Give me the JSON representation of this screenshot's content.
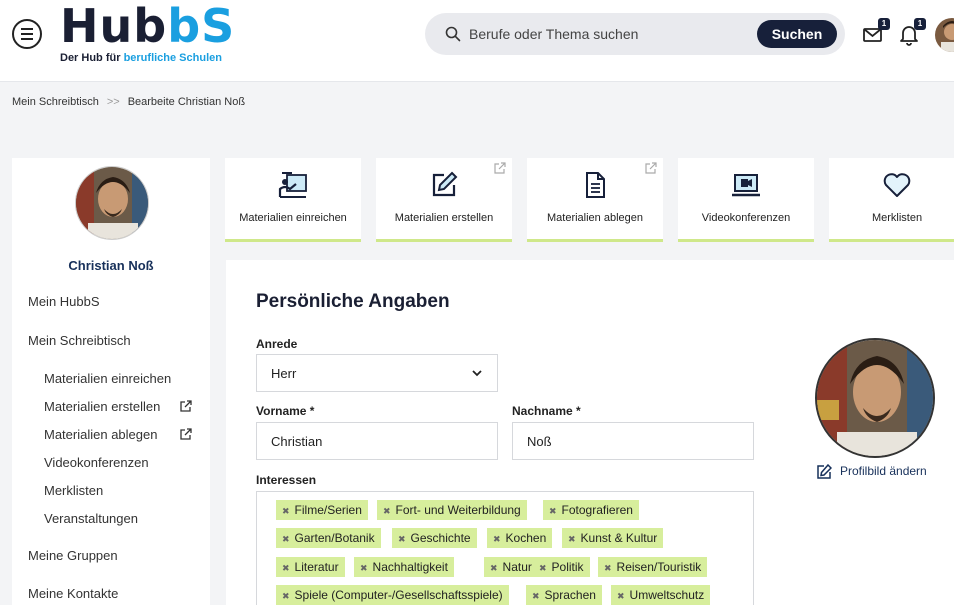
{
  "header": {
    "logo": {
      "word_dark": "Hub",
      "word_blue": "bS",
      "tagline_dark": "Der Hub für ",
      "tagline_blue": "berufliche Schulen"
    },
    "search": {
      "placeholder": "Berufe oder Thema suchen",
      "button_label": "Suchen"
    },
    "notifications": {
      "messages_count": "1",
      "bell_count": "1"
    }
  },
  "breadcrumb": {
    "items": [
      "Mein Schreibtisch",
      "Bearbeite Christian Noß"
    ],
    "separator": ">>"
  },
  "sidebar": {
    "user_name": "Christian Noß",
    "items": [
      {
        "label": "Mein HubbS"
      },
      {
        "label": "Mein Schreibtisch"
      },
      {
        "label": "Materialien einreichen"
      },
      {
        "label": "Materialien erstellen"
      },
      {
        "label": "Materialien ablegen"
      },
      {
        "label": "Videokonferenzen"
      },
      {
        "label": "Merklisten"
      },
      {
        "label": "Veranstaltungen"
      },
      {
        "label": "Meine Gruppen"
      },
      {
        "label": "Meine Kontakte"
      }
    ]
  },
  "tiles": [
    {
      "label": "Materialien einreichen",
      "icon": "presenter-icon"
    },
    {
      "label": "Materialien erstellen",
      "icon": "edit-icon"
    },
    {
      "label": "Materialien ablegen",
      "icon": "document-icon"
    },
    {
      "label": "Videokonferenzen",
      "icon": "video-icon"
    },
    {
      "label": "Merklisten",
      "icon": "heart-icon"
    }
  ],
  "form": {
    "title": "Persönliche Angaben",
    "anrede": {
      "label": "Anrede",
      "value": "Herr"
    },
    "vorname": {
      "label": "Vorname *",
      "value": "Christian"
    },
    "nachname": {
      "label": "Nachname *",
      "value": "Noß"
    },
    "interessen": {
      "label": "Interessen",
      "tags": [
        "Filme/Serien",
        "Fort- und Weiterbildung",
        "Fotografieren",
        "Garten/Botanik",
        "Geschichte",
        "Kochen",
        "Kunst & Kultur",
        "Literatur",
        "Nachhaltigkeit",
        "Natur",
        "Politik",
        "Reisen/Touristik",
        "Spiele (Computer-/Gesellschaftsspiele)",
        "Sprachen",
        "Umweltschutz"
      ]
    },
    "profile_change_label": "Profilbild ändern"
  },
  "colors": {
    "navy": "#17203a",
    "brand_blue": "#1a9fe0",
    "accent_green": "#d7ee9c"
  }
}
